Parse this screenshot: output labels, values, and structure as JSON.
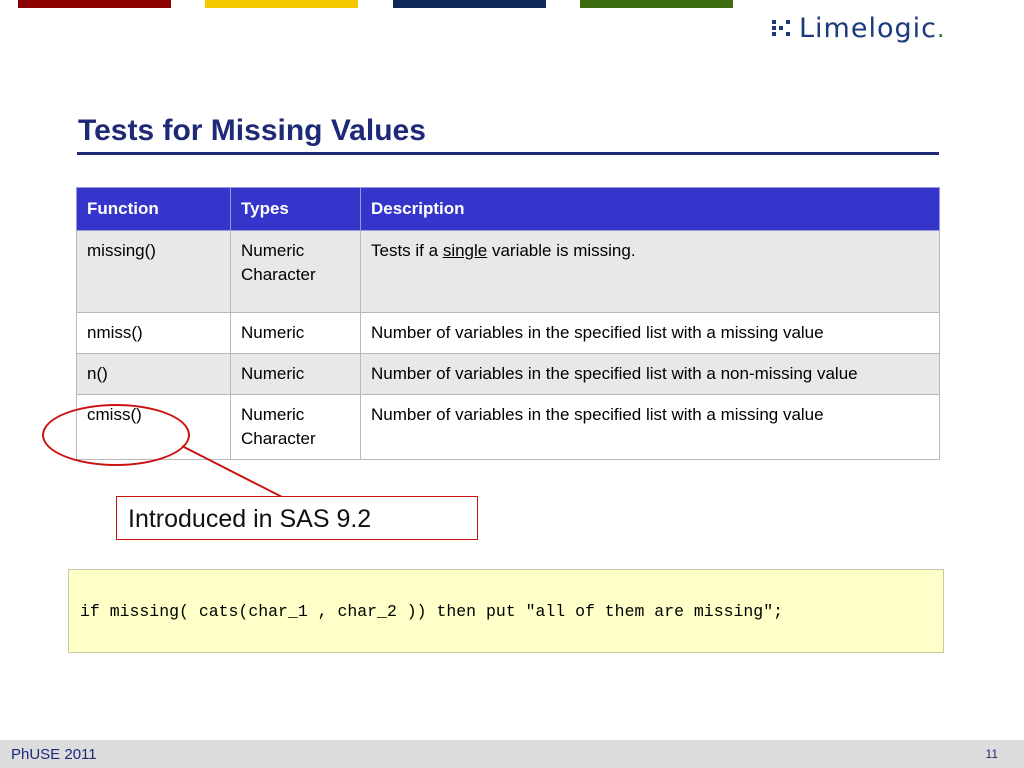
{
  "brand": {
    "logo_text": "Limelogic",
    "logo_period": ".",
    "bar_colors": [
      "#8b0000",
      "#f5c800",
      "#0f2a5a",
      "#3d6b12"
    ]
  },
  "slide": {
    "title": "Tests for Missing Values"
  },
  "table": {
    "headers": [
      "Function",
      "Types",
      "Description"
    ],
    "rows": [
      {
        "function": "missing()",
        "types": [
          "Numeric",
          "Character"
        ],
        "desc_before": "Tests if a ",
        "desc_underlined": "single",
        "desc_after": " variable is missing."
      },
      {
        "function": "nmiss()",
        "types": [
          "Numeric"
        ],
        "description": "Number of variables in the specified list with a missing value"
      },
      {
        "function": "n()",
        "types": [
          "Numeric"
        ],
        "description": "Number of variables in the specified list with a non-missing value"
      },
      {
        "function": "cmiss()",
        "types": [
          "Numeric",
          "Character"
        ],
        "description": "Number of variables in the specified list with a missing value"
      }
    ]
  },
  "callout": {
    "text": "Introduced in SAS 9.2",
    "color": "#cc1111"
  },
  "code": {
    "text": "if missing( cats(char_1 , char_2 )) then put \"all of them are missing\";"
  },
  "footer": {
    "left": "PhUSE 2011",
    "page_number": "11"
  }
}
